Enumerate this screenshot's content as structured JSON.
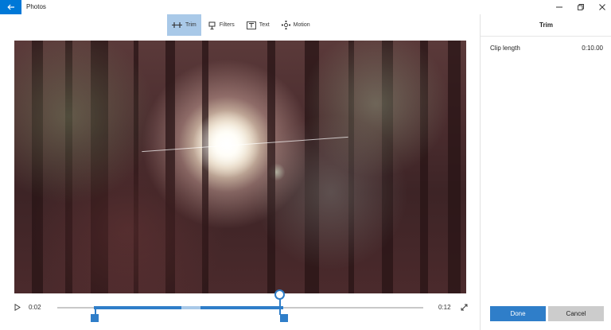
{
  "window": {
    "title": "Photos",
    "icons": {
      "back": "back-arrow-icon",
      "minimize": "minimize-icon",
      "maximize": "restore-icon",
      "close": "close-icon"
    }
  },
  "toolbar": {
    "tools": [
      {
        "label": "Trim",
        "icon": "trim-icon",
        "active": true
      },
      {
        "label": "Filters",
        "icon": "filters-icon",
        "active": false
      },
      {
        "label": "Text",
        "icon": "text-icon",
        "active": false
      },
      {
        "label": "Motion",
        "icon": "motion-icon",
        "active": false
      }
    ]
  },
  "player": {
    "current_time": "0:02",
    "end_time": "0:12",
    "trim": {
      "start_fraction": 0.1,
      "end_fraction": 0.61,
      "playhead_fraction": 0.59
    },
    "colors": {
      "accent": "#2f7ec9"
    }
  },
  "panel": {
    "title": "Trim",
    "clip_length_label": "Clip length",
    "clip_length_value": "0:10.00",
    "done_label": "Done",
    "cancel_label": "Cancel"
  }
}
